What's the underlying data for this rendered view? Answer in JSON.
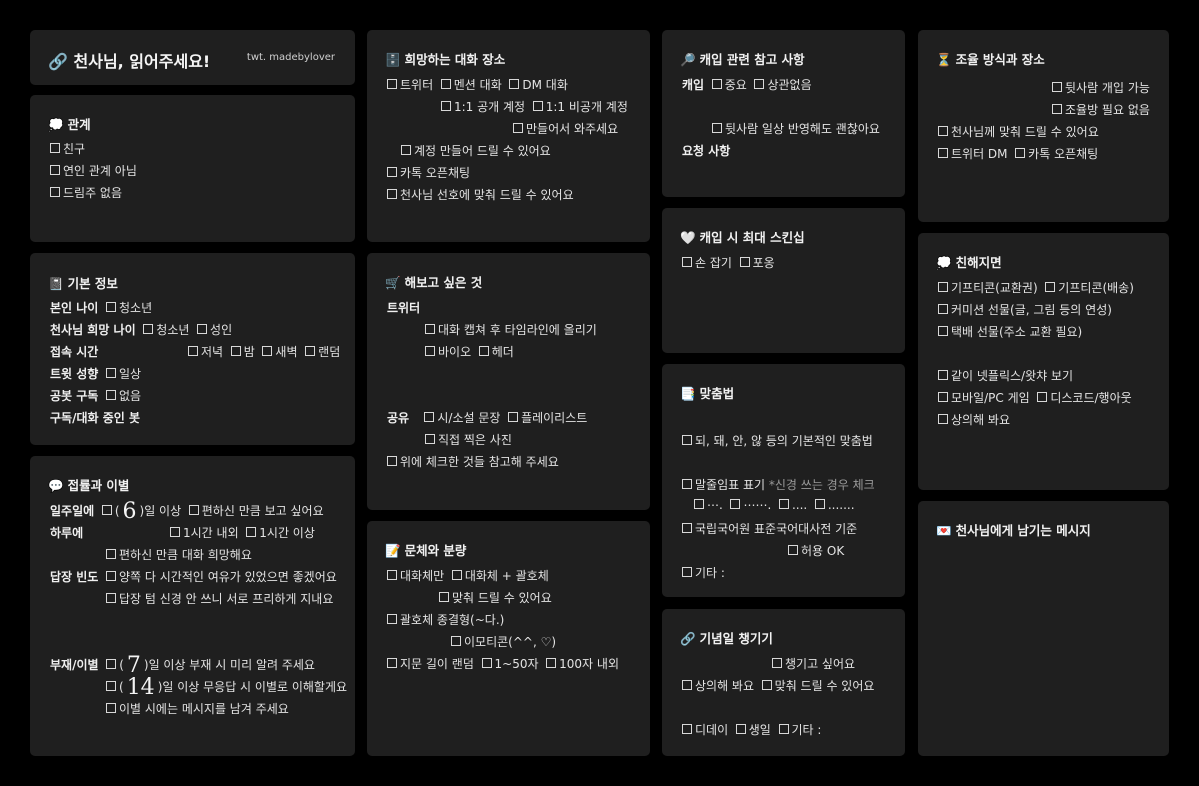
{
  "header": {
    "icon": "🔗",
    "title": "천사님, 읽어주세요!",
    "credit": "twt. madebylover"
  },
  "relation": {
    "icon": "💭",
    "title": "관계",
    "items": [
      "친구",
      "연인 관계 아님",
      "드림주 없음"
    ]
  },
  "basic": {
    "icon": "📓",
    "title": "기본 정보",
    "age_label": "본인 나이",
    "age_opt": "청소년",
    "want_age_label": "천사님 희망 나이",
    "want_age_opts": [
      "청소년",
      "성인"
    ],
    "time_label": "접속 시간",
    "time_opts": [
      "저녁",
      "밤",
      "새벽",
      "랜덤"
    ],
    "tweet_label": "트윗 성향",
    "tweet_opt": "일상",
    "sub_label": "공봇 구독",
    "sub_opt": "없음",
    "bot_label": "구독/대화 중인 봇"
  },
  "contact": {
    "icon": "💬",
    "title": "접률과 이별",
    "week_label": "일주일에",
    "week_num": "6",
    "week_text": "일 이상",
    "week_opt2": "편하신 만큼 보고 싶어요",
    "day_label": "하루에",
    "day_opts": [
      "1시간 내외",
      "1시간 이상"
    ],
    "day_opt3": "편하신 만큼  대화 희망해요",
    "reply_label": "답장 빈도",
    "reply_opts": [
      "양쪽 다 시간적인 여유가 있었으면 좋겠어요",
      "답장 텀 신경 안 쓰니 서로 프리하게 지내요"
    ],
    "absence_label": "부재/이별",
    "absence_num1": "7",
    "absence_text1": "일 이상 부재 시 미리 알려 주세요",
    "absence_num2": "14",
    "absence_text2": "일 이상 무응답 시 이별로 이해할게요",
    "absence_opt3": "이별 시에는 메시지를 남겨 주세요"
  },
  "place": {
    "icon": "🗄️",
    "title": "희망하는 대화 장소",
    "row1": [
      "트위터",
      "멘션 대화",
      "DM 대화"
    ],
    "row2": [
      "1:1 공개 계정",
      "1:1 비공개 계정"
    ],
    "row3": "만들어서 와주세요",
    "row4": "계정 만들어 드릴 수 있어요",
    "row5": "카톡 오픈채팅",
    "row6": "천사님 선호에 맞춰 드릴 수 있어요"
  },
  "wish": {
    "icon": "🛒",
    "title": "해보고 싶은 것",
    "twitter_label": "트위터",
    "tw_opt1": "대화 캡쳐 후 타임라인에 올리기",
    "tw_opts2": [
      "바이오",
      "헤더"
    ],
    "share_label": "공유",
    "share_opts": [
      "시/소설 문장",
      "플레이리스트"
    ],
    "share_opt3": "직접 찍은 사진",
    "ref": "위에 체크한 것들 참고해 주세요"
  },
  "style": {
    "icon": "📝",
    "title": "문체와 분량",
    "row1": [
      "대화체만",
      "대화체 + 괄호체"
    ],
    "row2": "맞춰 드릴 수 있어요",
    "row3": "괄호체 종결형(~다.)",
    "row4": "이모티콘(^^, ♡)",
    "row5_label": "지문 길이 랜덤",
    "row5_opts": [
      "1~50자",
      "100자 내외"
    ]
  },
  "cap": {
    "icon": "🔎",
    "title": "캐입 관련 참고 사항",
    "cap_label": "캐입",
    "cap_opts": [
      "중요",
      "상관없음"
    ],
    "cap_opt3": "뒷사람 일상 반영해도 괜찮아요",
    "req_label": "요청 사항"
  },
  "skinship": {
    "icon": "🤍",
    "title": "캐입 시 최대 스킨십",
    "opts": [
      "손 잡기",
      "포옹"
    ]
  },
  "spelling": {
    "icon": "📑",
    "title": "맞춤법",
    "opt1": "되, 돼, 안, 않 등의 기본적인 맞춤법",
    "opt2": "말줄임표 표기",
    "opt2_note": "*신경 쓰는 경우 체크",
    "dots": [
      "⋯.",
      "⋯⋯.",
      "....",
      "......."
    ],
    "opt3": "국립국어원 표준국어대사전 기준",
    "opt4": "허용 OK",
    "opt5": "기타 :"
  },
  "anniv": {
    "icon": "🔗",
    "title": "기념일 챙기기",
    "opt1": "챙기고 싶어요",
    "row2": [
      "상의해 봐요",
      "맞춰 드릴 수 있어요"
    ],
    "row3": [
      "디데이",
      "생일",
      "기타 :"
    ]
  },
  "adjust": {
    "icon": "⏳",
    "title": "조율 방식과 장소",
    "opt1": "뒷사람 개입 가능",
    "opt2": "조율방 필요 없음",
    "opt3": "천사님께 맞춰 드릴 수 있어요",
    "row4": [
      "트위터 DM",
      "카톡 오픈채팅"
    ]
  },
  "close": {
    "icon": "💭",
    "title": "친해지면",
    "row1": [
      "기프티콘(교환권)",
      "기프티콘(배송)"
    ],
    "opt2": "커미션 선물(글, 그림 등의 연성)",
    "opt3": "택배 선물(주소 교환 필요)",
    "opt4": "같이 넷플릭스/왓챠 보기",
    "row5": [
      "모바일/PC 게임",
      "디스코드/행아웃"
    ],
    "opt6": "상의해 봐요"
  },
  "message": {
    "icon": "💌",
    "title": "천사님에게 남기는 메시지"
  },
  "colors": {
    "background": "#000000",
    "card": "#1f1f1f",
    "text": "#e6e6e6"
  }
}
